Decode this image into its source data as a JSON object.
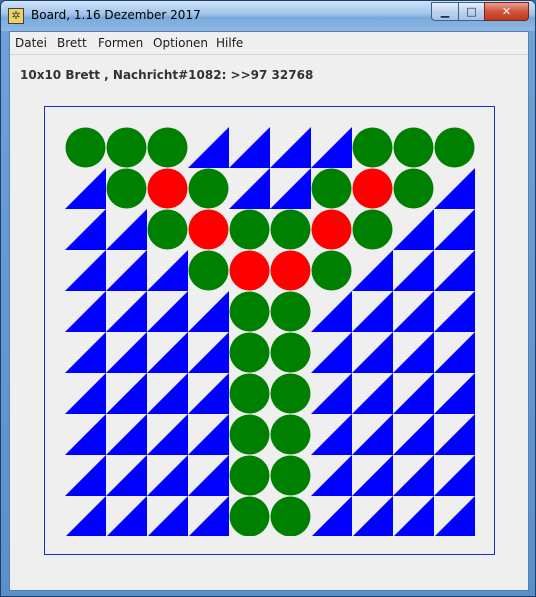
{
  "window": {
    "title": "Board, 1.16 Dezember 2017",
    "app_icon": "board-app-icon",
    "controls": [
      "minimize-icon",
      "maximize-icon",
      "close-icon"
    ]
  },
  "menu": {
    "items": [
      {
        "label": "Datei"
      },
      {
        "label": "Brett"
      },
      {
        "label": "Formen"
      },
      {
        "label": "Optionen"
      },
      {
        "label": "Hilfe"
      }
    ]
  },
  "status": {
    "text": "10x10 Brett , Nachricht#1082: >>97 32768"
  },
  "board": {
    "rows": 10,
    "cols": 10,
    "colors": {
      "triangle": "#0000ff",
      "circle_green": "#008000",
      "circle_red": "#ff0000",
      "frame": "#1a2fbf",
      "background": "#efefef"
    },
    "legend": {
      "G": "green circle",
      "R": "red circle",
      "L": "blue triangle, lower-left half",
      "R2": "blue triangle, lower-right half"
    },
    "grid": [
      [
        "G",
        "G",
        "G",
        "R2",
        "R2",
        "R2",
        "R2",
        "G",
        "G",
        "G"
      ],
      [
        "R2",
        "G",
        "R",
        "G",
        "R2",
        "R2",
        "G",
        "R",
        "G",
        "R2"
      ],
      [
        "R2",
        "R2",
        "G",
        "R",
        "G",
        "G",
        "R",
        "G",
        "R2",
        "R2"
      ],
      [
        "R2",
        "R2",
        "R2",
        "G",
        "R",
        "R",
        "G",
        "R2",
        "R2",
        "R2"
      ],
      [
        "R2",
        "R2",
        "R2",
        "R2",
        "G",
        "G",
        "R2",
        "R2",
        "R2",
        "R2"
      ],
      [
        "R2",
        "R2",
        "R2",
        "R2",
        "G",
        "G",
        "R2",
        "R2",
        "R2",
        "R2"
      ],
      [
        "R2",
        "R2",
        "R2",
        "R2",
        "G",
        "G",
        "R2",
        "R2",
        "R2",
        "R2"
      ],
      [
        "R2",
        "R2",
        "R2",
        "R2",
        "G",
        "G",
        "R2",
        "R2",
        "R2",
        "R2"
      ],
      [
        "R2",
        "R2",
        "R2",
        "R2",
        "G",
        "G",
        "R2",
        "R2",
        "R2",
        "R2"
      ],
      [
        "R2",
        "R2",
        "R2",
        "R2",
        "G",
        "G",
        "R2",
        "R2",
        "R2",
        "R2"
      ]
    ]
  }
}
